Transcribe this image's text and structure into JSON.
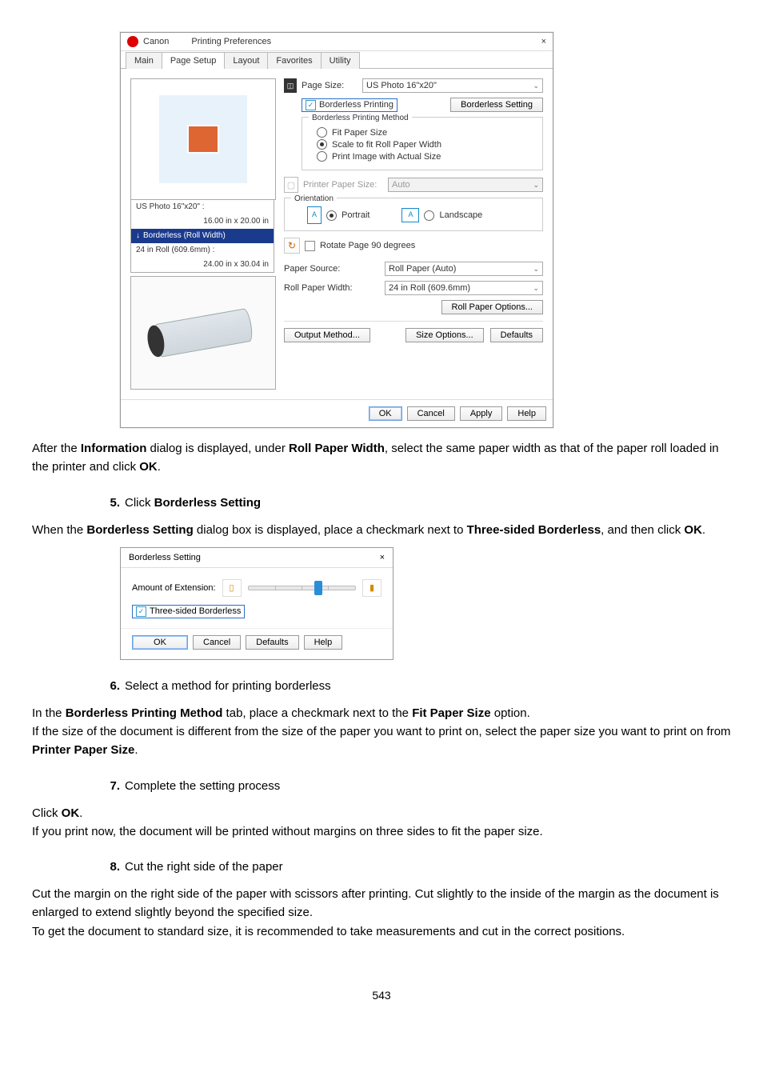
{
  "dlg": {
    "title_brand": "Canon",
    "title_text": "Printing Preferences",
    "close_glyph": "×",
    "tabs": [
      "Main",
      "Page Setup",
      "Layout",
      "Favorites",
      "Utility"
    ],
    "active_tab_index": 1,
    "preview": {
      "line1_a": "US Photo 16\"x20\" :",
      "line1_b": "16.00 in x 20.00 in",
      "arrow_text": "Borderless (Roll Width)",
      "line2_a": "24 in Roll (609.6mm) :",
      "line2_b": "24.00 in x 30.04 in"
    },
    "page_size": {
      "label": "Page Size:",
      "value": "US Photo 16\"x20\""
    },
    "borderless_check": "Borderless Printing",
    "borderless_btn": "Borderless Setting",
    "method_group_title": "Borderless Printing Method",
    "method_options": {
      "fit": "Fit Paper Size",
      "scale": "Scale to fit Roll Paper Width",
      "actual": "Print Image with Actual Size"
    },
    "printer_paper_size": {
      "label": "Printer Paper Size:",
      "value": "Auto"
    },
    "orientation": {
      "group": "Orientation",
      "portrait": "Portrait",
      "landscape": "Landscape"
    },
    "rotate_check": "Rotate Page 90 degrees",
    "paper_source": {
      "label": "Paper Source:",
      "value": "Roll Paper (Auto)"
    },
    "roll_width": {
      "label": "Roll Paper Width:",
      "value": "24 in Roll (609.6mm)"
    },
    "roll_options_btn": "Roll Paper Options...",
    "output_method_btn": "Output Method...",
    "size_options_btn": "Size Options...",
    "defaults_btn": "Defaults",
    "footer": {
      "ok": "OK",
      "cancel": "Cancel",
      "apply": "Apply",
      "help": "Help"
    }
  },
  "para_after_dlg": {
    "t1": "After the ",
    "b1": "Information",
    "t2": " dialog is displayed, under ",
    "b2": "Roll Paper Width",
    "t3": ", select the same paper width as that of the paper roll loaded in the printer and click ",
    "b3": "OK",
    "t4": "."
  },
  "step5": {
    "num": "5.",
    "title_pre": "Click ",
    "title_bold": "Borderless Setting",
    "body_t1": "When the ",
    "body_b1": "Borderless Setting",
    "body_t2": " dialog box is displayed, place a checkmark next to ",
    "body_b2": "Three-sided Borderless",
    "body_t3": ", and then click ",
    "body_b3": "OK",
    "body_t4": "."
  },
  "dlg2": {
    "title": "Borderless Setting",
    "close_glyph": "×",
    "amount_label": "Amount of Extension:",
    "three_sided_label": "Three-sided Borderless",
    "ok": "OK",
    "cancel": "Cancel",
    "defaults": "Defaults",
    "help": "Help"
  },
  "step6": {
    "num": "6.",
    "title": "Select a method for printing borderless",
    "p1_t1": "In the ",
    "p1_b1": "Borderless Printing Method",
    "p1_t2": " tab, place a checkmark next to the ",
    "p1_b2": "Fit Paper Size",
    "p1_t3": " option.",
    "p2_t1": "If the size of the document is different from the size of the paper you want to print on, select the paper size you want to print on from ",
    "p2_b1": "Printer Paper Size",
    "p2_t2": "."
  },
  "step7": {
    "num": "7.",
    "title": "Complete the setting process",
    "p1_t1": "Click ",
    "p1_b1": "OK",
    "p1_t2": ".",
    "p2": "If you print now, the document will be printed without margins on three sides to fit the paper size."
  },
  "step8": {
    "num": "8.",
    "title": "Cut the right side of the paper",
    "p1": "Cut the margin on the right side of the paper with scissors after printing. Cut slightly to the inside of the margin as the document is enlarged to extend slightly beyond the specified size.",
    "p2": "To get the document to standard size, it is recommended to take measurements and cut in the correct positions."
  },
  "page_number": "543"
}
